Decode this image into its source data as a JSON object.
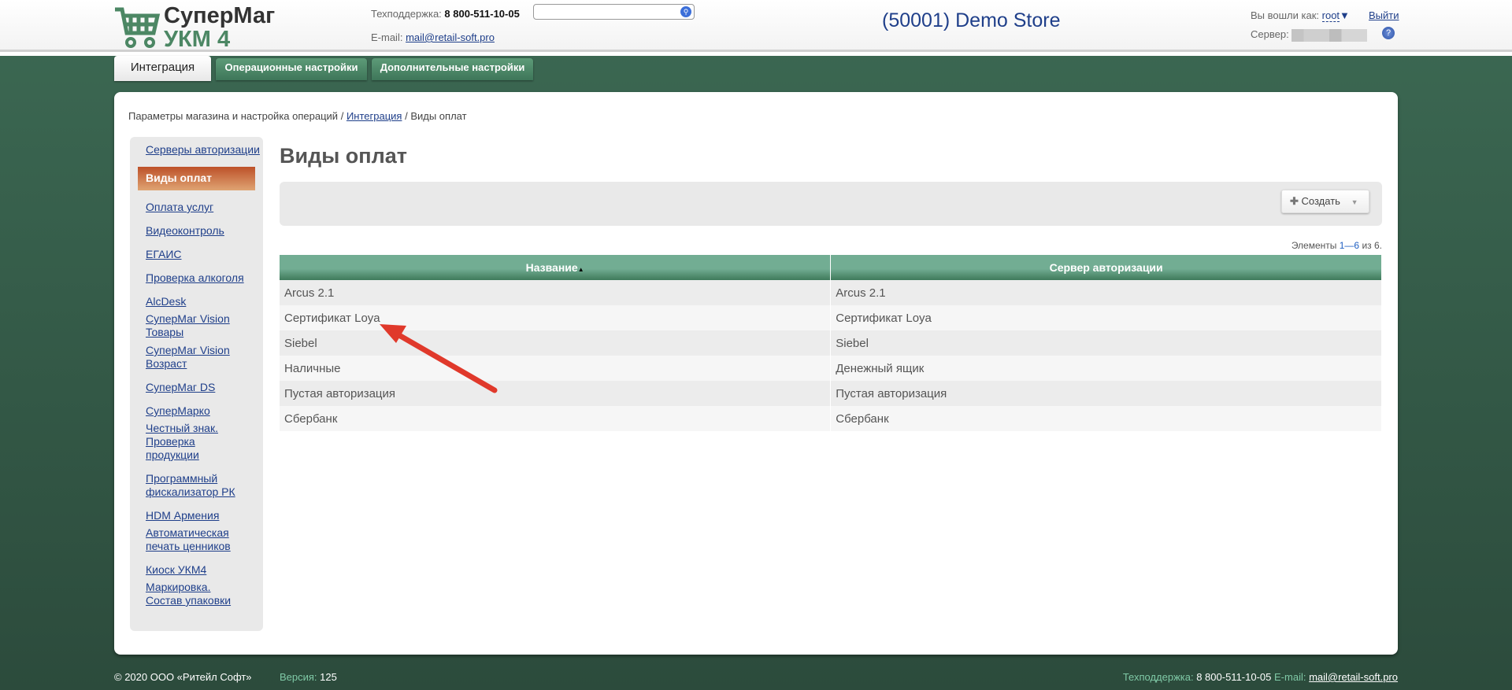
{
  "header": {
    "brand_line1": "СуперМаг",
    "brand_line2": "УКМ 4",
    "support_label": "Техподдержка:",
    "support_phone": "8 800-511-10-05",
    "email_label": "E-mail:",
    "email": "mail@retail-soft.pro",
    "store": "(50001) Demo Store",
    "login_label": "Вы вошли как:",
    "user": "root",
    "logout": "Выйти",
    "server_label": "Сервер:",
    "help": "?"
  },
  "tabs": [
    {
      "label": "Интеграция"
    },
    {
      "label": "Операционные настройки"
    },
    {
      "label": "Дополнительные настройки"
    }
  ],
  "breadcrumb": {
    "root": "Параметры магазина и настройка операций",
    "sep": "/",
    "link": "Интеграция",
    "current": "Виды оплат"
  },
  "sidebar": {
    "items": [
      "Серверы авторизации",
      "Виды оплат",
      "Оплата услуг",
      "Видеоконтроль",
      "ЕГАИС",
      "Проверка алкоголя",
      "AlcDesk",
      "СуперМаг Vision Товары",
      "СуперМаг Vision Возраст",
      "СуперМаг DS",
      "СуперМарко",
      "Честный знак. Проверка продукции",
      "Программный фискализатор РК",
      "HDM Армения",
      "Автоматическая печать ценников",
      "Киоск УКМ4",
      "Маркировка. Состав упаковки"
    ]
  },
  "main": {
    "title": "Виды оплат",
    "create": "Создать",
    "count_prefix": "Элементы",
    "count_range": "1—6",
    "count_suffix": "из 6.",
    "columns": [
      "Название",
      "Сервер авторизации"
    ],
    "rows": [
      [
        "Arcus 2.1",
        "Arcus 2.1"
      ],
      [
        "Сертификат Loya",
        "Сертификат Loya"
      ],
      [
        "Siebel",
        "Siebel"
      ],
      [
        "Наличные",
        "Денежный ящик"
      ],
      [
        "Пустая авторизация",
        "Пустая авторизация"
      ],
      [
        "Сбербанк",
        "Сбербанк"
      ]
    ]
  },
  "footer": {
    "copyright": "© 2020 ООО «Ритейл Софт»",
    "version_label": "Версия:",
    "version": "125",
    "support_label": "Техподдержка:",
    "support_phone": "8 800-511-10-05",
    "email_label": "E-mail:",
    "email": "mail@retail-soft.pro"
  },
  "colors": {
    "accent_green": "#3c6953",
    "active_orange": "#bd5129",
    "link": "#1f3f8a",
    "arrow": "#e0392b"
  }
}
